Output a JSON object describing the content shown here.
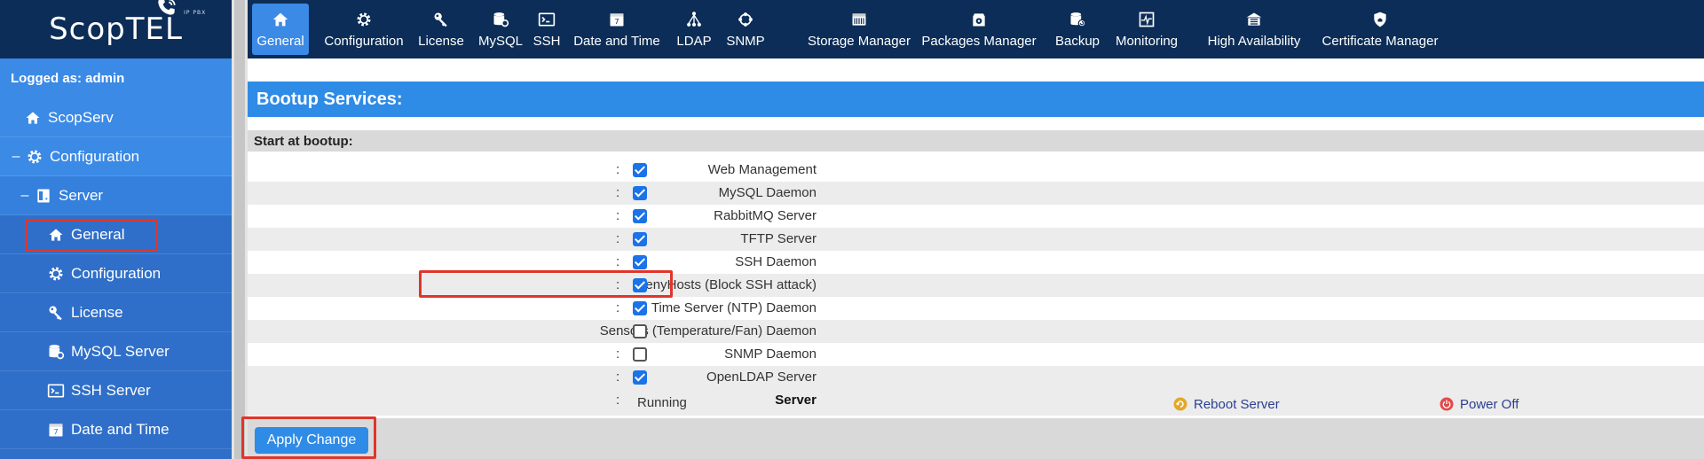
{
  "app": {
    "logo_text": "ScopTEL",
    "logo_tag": "IP PBX",
    "logged_as": "Logged as: admin"
  },
  "sidebar": {
    "items": [
      {
        "label": "ScopServ",
        "icon": "home-icon"
      },
      {
        "label": "Configuration",
        "icon": "gear-icon",
        "expander": "–"
      },
      {
        "label": "Server",
        "icon": "server-icon",
        "expander": "–"
      },
      {
        "label": "General",
        "icon": "home-icon",
        "highlighted": true
      },
      {
        "label": "Configuration",
        "icon": "gear-icon"
      },
      {
        "label": "License",
        "icon": "key-icon"
      },
      {
        "label": "MySQL Server",
        "icon": "database-gear-icon"
      },
      {
        "label": "SSH Server",
        "icon": "terminal-icon"
      },
      {
        "label": "Date and Time",
        "icon": "calendar-icon"
      }
    ]
  },
  "toolbar": {
    "items": [
      {
        "label": "General",
        "icon": "home-icon",
        "active": true
      },
      {
        "label": "Configuration",
        "icon": "gear-icon"
      },
      {
        "label": "License",
        "icon": "key-icon"
      },
      {
        "label": "MySQL",
        "icon": "database-gear-icon"
      },
      {
        "label": "SSH",
        "icon": "terminal-icon"
      },
      {
        "label": "Date and Time",
        "icon": "calendar-icon"
      },
      {
        "label": "LDAP",
        "icon": "tree-icon"
      },
      {
        "label": "SNMP",
        "icon": "network-ring-icon"
      },
      {
        "label": "Storage Manager",
        "icon": "storage-icon"
      },
      {
        "label": "Packages Manager",
        "icon": "package-icon"
      },
      {
        "label": "Backup",
        "icon": "backup-icon"
      },
      {
        "label": "Monitoring",
        "icon": "monitor-chart-icon"
      },
      {
        "label": "High Availability",
        "icon": "ha-building-icon"
      },
      {
        "label": "Certificate Manager",
        "icon": "shield-icon"
      }
    ]
  },
  "main": {
    "title": "Bootup Services:",
    "section_header": "Start at bootup:",
    "colon": ":",
    "services": [
      {
        "label": "Web Management",
        "checked": true
      },
      {
        "label": "MySQL Daemon",
        "checked": true
      },
      {
        "label": "RabbitMQ Server",
        "checked": true
      },
      {
        "label": "TFTP Server",
        "checked": true
      },
      {
        "label": "SSH Daemon",
        "checked": true
      },
      {
        "label": "DenyHosts (Block SSH attack)",
        "checked": true,
        "highlighted": true
      },
      {
        "label": "Time Server (NTP) Daemon",
        "checked": true
      },
      {
        "label": "Sensors (Temperature/Fan) Daemon",
        "checked": false
      },
      {
        "label": "SNMP Daemon",
        "checked": false
      },
      {
        "label": "OpenLDAP Server",
        "checked": true
      }
    ],
    "server": {
      "label": "Server",
      "status": "Running",
      "reboot_label": "Reboot Server",
      "poweroff_label": "Power Off"
    },
    "apply_label": "Apply Change"
  },
  "colors": {
    "accent": "#2e8be6",
    "dark_navy": "#0c2d57",
    "sidebar_blue": "#2f6fc9",
    "highlight_red": "#e0352b"
  }
}
